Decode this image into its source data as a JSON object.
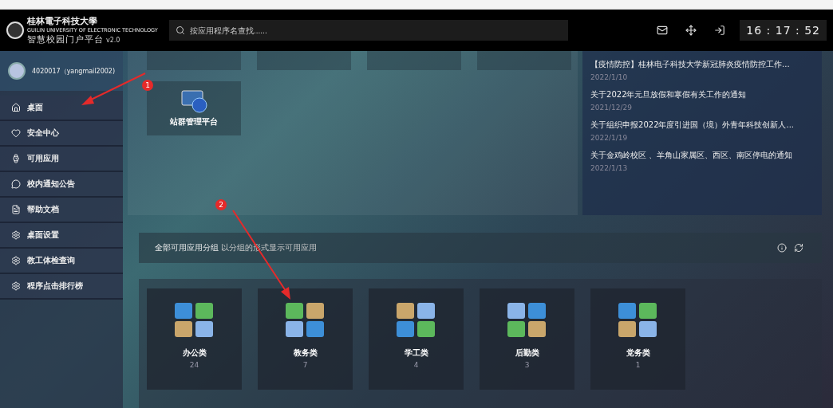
{
  "header": {
    "logo_name": "桂林電子科技大學",
    "logo_subtitle": "GUILIN UNIVERSITY OF ELECTRONIC TECHNOLOGY",
    "portal_title": "智慧校园门户平台",
    "version": "v2.0",
    "search": {
      "placeholder": "按应用程序名查找......"
    },
    "clock": "16 : 17 : 52"
  },
  "user": {
    "name": "4020017（yangmail2002)"
  },
  "sidebar": {
    "items": [
      {
        "label": "桌面"
      },
      {
        "label": "安全中心"
      },
      {
        "label": "可用应用"
      },
      {
        "label": "校内通知公告"
      },
      {
        "label": "帮助文档"
      },
      {
        "label": "桌面设置"
      },
      {
        "label": "教工体检查询"
      },
      {
        "label": "程序点击排行榜"
      }
    ]
  },
  "desktop_tile": {
    "label": "站群管理平台"
  },
  "news": [
    {
      "title": "【疫情防控】桂林电子科技大学新冠肺炎疫情防控工作...",
      "date": "2022/1/10"
    },
    {
      "title": "关于2022年元旦放假和寒假有关工作的通知",
      "date": "2021/12/29"
    },
    {
      "title": "关于组织申报2022年度引进国（境）外青年科技创新人...",
      "date": "2022/1/19"
    },
    {
      "title": "关于金鸡岭校区 、羊角山家属区、西区、南区停电的通知",
      "date": "2022/1/13"
    }
  ],
  "groups_header": {
    "title": "全部可用应用分组",
    "subtitle": "以分组的形式显示可用应用"
  },
  "groups": [
    {
      "name": "办公类",
      "count": "24"
    },
    {
      "name": "教务类",
      "count": "7"
    },
    {
      "name": "学工类",
      "count": "4"
    },
    {
      "name": "后勤类",
      "count": "3"
    },
    {
      "name": "党务类",
      "count": "1"
    }
  ],
  "annotations": [
    "1",
    "2"
  ]
}
